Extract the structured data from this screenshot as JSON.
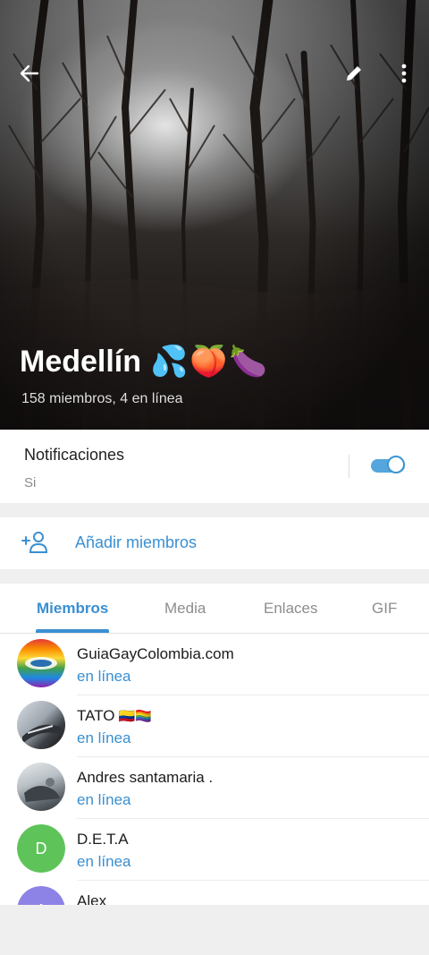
{
  "header": {
    "back_icon": "arrow-back-icon",
    "edit_icon": "pencil-icon",
    "menu_icon": "more-vert-icon",
    "group_name": "Medellín",
    "emojis": [
      "💦",
      "🍑",
      "🍆"
    ],
    "subtitle": "158 miembros, 4 en línea"
  },
  "notifications": {
    "label": "Notificaciones",
    "value": "Si",
    "enabled": true
  },
  "add_members": {
    "label": "Añadir miembros",
    "icon": "add-user-icon"
  },
  "tabs": [
    {
      "label": "Miembros",
      "active": true
    },
    {
      "label": "Media",
      "active": false
    },
    {
      "label": "Enlaces",
      "active": false
    },
    {
      "label": "GIF",
      "active": false
    }
  ],
  "members": [
    {
      "name": "GuiaGayColombia.com",
      "flags": "",
      "status": "en línea",
      "avatar": "rainbow-logo"
    },
    {
      "name": "TATO",
      "flags": "🇨🇴🏳️‍🌈",
      "status": "en línea",
      "avatar": "photo"
    },
    {
      "name": "Andres santamaria .",
      "flags": "",
      "status": "en línea",
      "avatar": "photo"
    },
    {
      "name": "D.E.T.A",
      "flags": "",
      "status": "en línea",
      "avatar": "initial",
      "initial": "D",
      "color": "#5ec45a"
    },
    {
      "name": "Alex",
      "flags": "",
      "status": "",
      "avatar": "initial",
      "initial": "A",
      "color": "#8d82e6"
    }
  ],
  "colors": {
    "accent": "#3a8fd1",
    "online": "#3a8fd1",
    "toggle_on": "#55a6dd"
  }
}
